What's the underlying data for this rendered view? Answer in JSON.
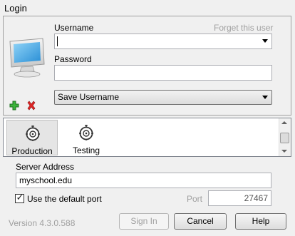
{
  "window": {
    "title": "Login"
  },
  "login": {
    "username_label": "Username",
    "forget_label": "Forget this user",
    "username_value": "",
    "password_label": "Password",
    "password_value": "",
    "save_option": "Save Username"
  },
  "icons": {
    "monitor": "computer-monitor-icon",
    "add": "green-plus-icon",
    "delete": "red-x-icon",
    "server": "server-target-icon"
  },
  "servers": {
    "items": [
      {
        "label": "Production",
        "selected": true
      },
      {
        "label": "Testing",
        "selected": false
      }
    ]
  },
  "server_address": {
    "label": "Server Address",
    "value": "myschool.edu"
  },
  "port": {
    "default_checkbox_label": "Use the default port",
    "default_checked": true,
    "label": "Port",
    "value": "27467"
  },
  "footer": {
    "version": "Version 4.3.0.588",
    "signin_label": "Sign In",
    "cancel_label": "Cancel",
    "help_label": "Help"
  },
  "colors": {
    "window_bg": "#f0f0f0",
    "disabled_text": "#a0a0a0",
    "add_green": "#2a9d2a",
    "delete_red": "#d02020"
  }
}
